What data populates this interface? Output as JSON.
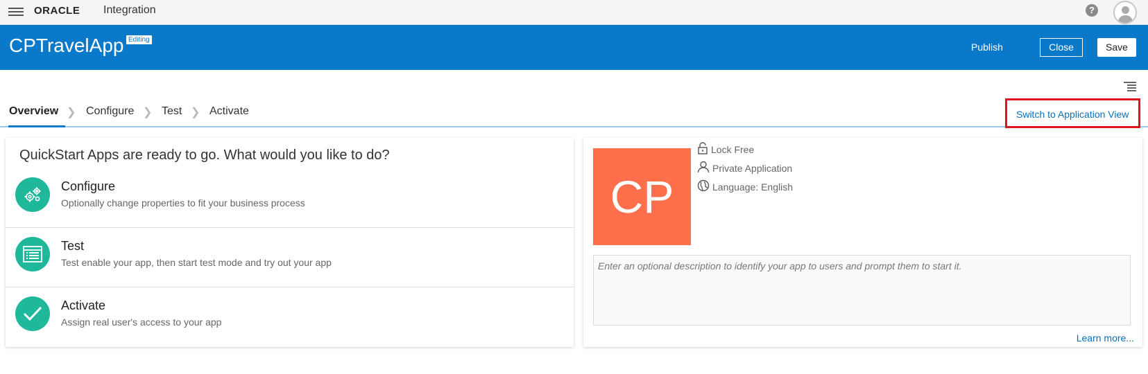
{
  "topbar": {
    "logo": "ORACLE",
    "product": "Integration",
    "help": "?"
  },
  "header": {
    "app_name": "CPTravelApp",
    "badge": "Editing",
    "publish": "Publish",
    "close": "Close",
    "save": "Save"
  },
  "train": {
    "steps": [
      {
        "label": "Overview"
      },
      {
        "label": "Configure"
      },
      {
        "label": "Test"
      },
      {
        "label": "Activate"
      }
    ],
    "switch_view": "Switch to Application View"
  },
  "quickstart": {
    "heading": "QuickStart Apps are ready to go. What would you like to do?",
    "actions": [
      {
        "title": "Configure",
        "description": "Optionally change properties to fit your business process"
      },
      {
        "title": "Test",
        "description": "Test enable your app, then start test mode and try out your app"
      },
      {
        "title": "Activate",
        "description": "Assign real user's access to your app"
      }
    ]
  },
  "app_info": {
    "initials": "CP",
    "lock": "Lock Free",
    "visibility": "Private Application",
    "language": "Language: English",
    "description_placeholder": "Enter an optional description to identify your app to users and prompt them to start it.",
    "learn_more": "Learn more..."
  },
  "colors": {
    "header_blue": "#0b79c9",
    "accent_teal": "#1fb89a",
    "tile_orange": "#ff6f4c",
    "highlight_red": "#e0121b"
  }
}
